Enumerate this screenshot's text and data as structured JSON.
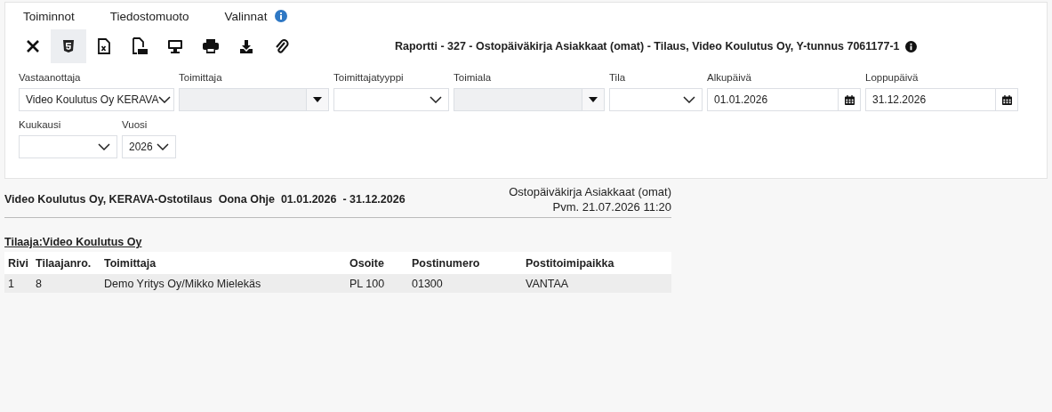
{
  "menu": [
    "Toiminnot",
    "Tiedostomuoto",
    "Valinnat"
  ],
  "toolbar": [
    {
      "kind": "close",
      "selected": false
    },
    {
      "kind": "html",
      "selected": true
    },
    {
      "kind": "excel",
      "selected": false
    },
    {
      "kind": "pdf",
      "selected": false
    },
    {
      "kind": "screen",
      "selected": false
    },
    {
      "kind": "print",
      "selected": false
    },
    {
      "kind": "download",
      "selected": false
    },
    {
      "kind": "attach",
      "selected": false
    }
  ],
  "report_title": "Raportti - 327 - Ostopäiväkirja Asiakkaat (omat) - Tilaus, Video Koulutus Oy, Y-tunnus 7061177-1",
  "filters": [
    [
      {
        "label": "Vastaanottaja",
        "kind": "select",
        "value": "Video Koulutus Oy KERAVA"
      },
      {
        "label": "Toimittaja",
        "kind": "combo",
        "disabled": true
      },
      {
        "label": "Toimittajatyyppi",
        "kind": "select"
      },
      {
        "label": "Toimiala",
        "kind": "combo",
        "disabled": true
      },
      {
        "label": "Tila",
        "kind": "select"
      },
      {
        "label": "Alkupäivä",
        "kind": "date",
        "value": "01.01.2026"
      },
      {
        "label": "Loppupäivä",
        "kind": "date",
        "value": "31.12.2026"
      }
    ],
    [
      {
        "label": "Kuukausi",
        "kind": "select"
      },
      {
        "label": "Vuosi",
        "kind": "select",
        "value": "2026"
      }
    ]
  ],
  "report": {
    "heading": "Video Koulutus Oy, KERAVA-Ostotilaus  Oona Ohje  01.01.2026  - 31.12.2026",
    "name": "Ostopäiväkirja Asiakkaat (omat)",
    "date": "Pvm. 21.07.2026 11:20",
    "group": "Tilaaja:Video Koulutus Oy",
    "columns": [
      "Rivi",
      "Tilaajanro.",
      "Toimittaja",
      "Osoite",
      "Postinumero",
      "Postitoimipaikka"
    ],
    "rows": [
      [
        "1",
        "8",
        "Demo Yritys Oy/Mikko Mielekäs",
        "PL 100",
        "01300",
        "VANTAA"
      ]
    ]
  }
}
